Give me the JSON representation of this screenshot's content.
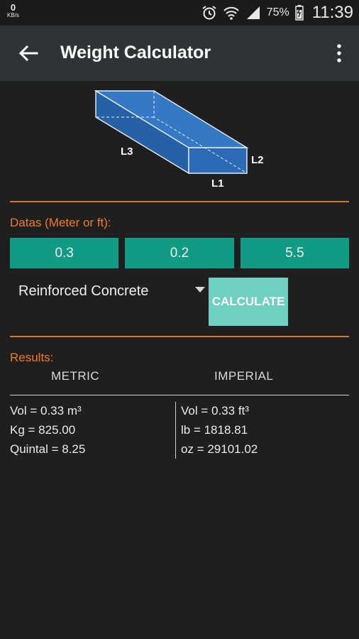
{
  "status_bar": {
    "net_speed": "0",
    "net_speed_unit": "KB/s",
    "battery_percent": "75%",
    "time": "11:39",
    "icons": [
      "alarm-icon",
      "wifi-icon",
      "signal-icon",
      "battery-icon"
    ]
  },
  "app_bar": {
    "title": "Weight Calculator",
    "back_icon": "arrow-left-icon",
    "menu_icon": "more-vert-icon"
  },
  "diagram": {
    "labels": {
      "l1": "L1",
      "l2": "L2",
      "l3": "L3"
    }
  },
  "inputs": {
    "section_label": "Datas (Meter or ft):",
    "values": [
      "0.3",
      "0.2",
      "5.5"
    ]
  },
  "material": {
    "selected": "Reinforced Concrete"
  },
  "calculate_label": "CALCULATE",
  "results": {
    "section_label": "Results:",
    "metric_header": "METRIC",
    "imperial_header": "IMPERIAL",
    "metric": {
      "vol": "Vol = 0.33 m³",
      "kg": "Kg = 825.00",
      "quintal": "Quintal = 8.25"
    },
    "imperial": {
      "vol": "Vol = 0.33 ft³",
      "lb": "lb = 1818.81",
      "oz": "oz = 29101.02"
    }
  },
  "colors": {
    "accent_orange": "#f07c22",
    "input_teal": "#119b84",
    "button_teal": "#6fcfc1",
    "app_bar": "#2e3436",
    "background": "#1f1f1f",
    "box_blue": "#2f6db6"
  }
}
